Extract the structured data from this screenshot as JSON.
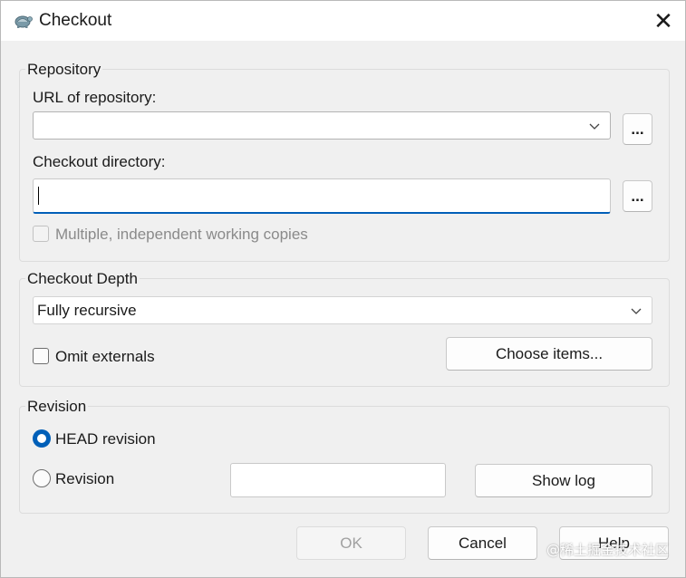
{
  "window": {
    "title": "Checkout",
    "close_symbol": "✕"
  },
  "repository": {
    "group_label": "Repository",
    "url_label": "URL of repository:",
    "url_value": "",
    "url_browse": "...",
    "dir_label": "Checkout directory:",
    "dir_value": "",
    "dir_browse": "...",
    "multiple_label": "Multiple, independent working copies",
    "multiple_checked": false
  },
  "depth": {
    "group_label": "Checkout Depth",
    "selected": "Fully recursive",
    "omit_label": "Omit externals",
    "omit_checked": false,
    "choose_items": "Choose items..."
  },
  "revision": {
    "group_label": "Revision",
    "head_label": "HEAD revision",
    "revision_label": "Revision",
    "selected": "HEAD revision",
    "revision_value": "",
    "show_log": "Show log"
  },
  "footer": {
    "ok": "OK",
    "cancel": "Cancel",
    "help": "Help"
  },
  "watermark": "@稀土掘金技术社区",
  "colors": {
    "accent": "#005fb8",
    "dialog_bg": "#f0f0f0"
  }
}
